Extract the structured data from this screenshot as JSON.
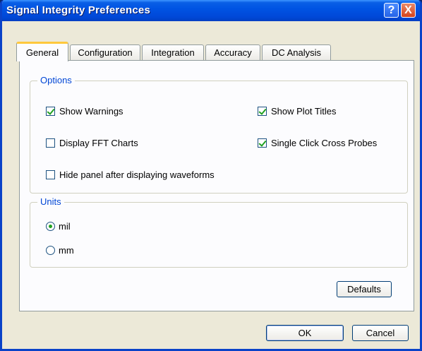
{
  "window": {
    "title": "Signal Integrity Preferences",
    "help_glyph": "?",
    "close_glyph": "X"
  },
  "tabs": [
    {
      "label": "General",
      "active": true
    },
    {
      "label": "Configuration",
      "active": false
    },
    {
      "label": "Integration",
      "active": false
    },
    {
      "label": "Accuracy",
      "active": false
    },
    {
      "label": "DC Analysis",
      "active": false
    }
  ],
  "options": {
    "group_label": "Options",
    "show_warnings": {
      "label": "Show Warnings",
      "checked": true
    },
    "show_plot_titles": {
      "label": "Show Plot Titles",
      "checked": true
    },
    "display_fft_charts": {
      "label": "Display FFT Charts",
      "checked": false
    },
    "single_click_cross_probes": {
      "label": "Single Click Cross Probes",
      "checked": true
    },
    "hide_panel": {
      "label": "Hide panel after displaying waveforms",
      "checked": false
    }
  },
  "units": {
    "group_label": "Units",
    "mil": {
      "label": "mil",
      "selected": true
    },
    "mm": {
      "label": "mm",
      "selected": false
    }
  },
  "buttons": {
    "defaults": "Defaults",
    "ok": "OK",
    "cancel": "Cancel"
  }
}
